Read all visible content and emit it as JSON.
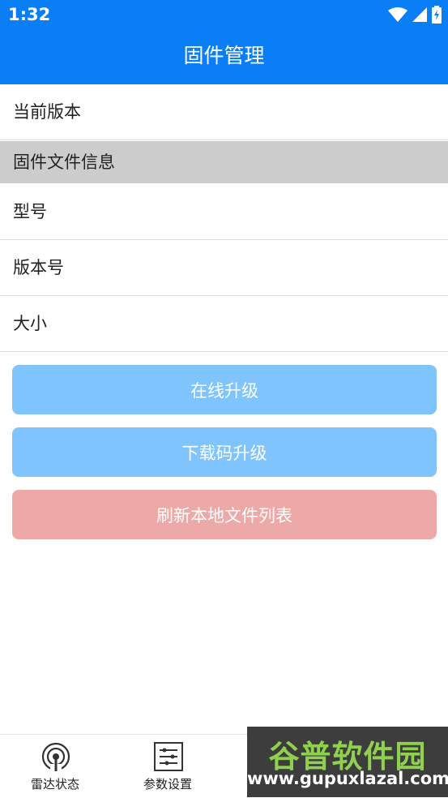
{
  "status_bar": {
    "time": "1:32"
  },
  "app_bar": {
    "title": "固件管理"
  },
  "rows": {
    "current_version": "当前版本",
    "model": "型号",
    "version_number": "版本号",
    "size": "大小"
  },
  "section_header": "固件文件信息",
  "buttons": {
    "online_upgrade": "在线升级",
    "download_upgrade": "下载码升级",
    "refresh_list": "刷新本地文件列表"
  },
  "bottom_nav": [
    {
      "label": "雷达状态",
      "icon": "radar-icon"
    },
    {
      "label": "参数设置",
      "icon": "settings-sliders-icon"
    }
  ],
  "watermark": {
    "title": "谷普软件园",
    "url": "www.gupuxlazal.com"
  },
  "colors": {
    "primary": "#0a7ff5",
    "button_blue": "#80c4fe",
    "button_red": "#eda9a7",
    "section_bg": "#cccccc"
  }
}
